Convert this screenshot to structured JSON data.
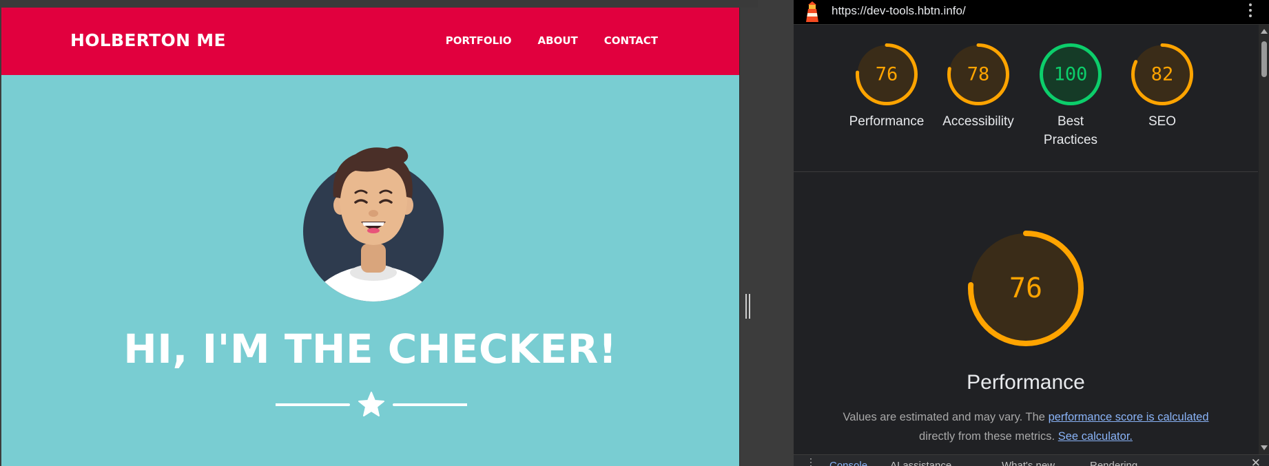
{
  "preview": {
    "brand": "HOLBERTON ME",
    "nav": [
      "PORTFOLIO",
      "ABOUT",
      "CONTACT"
    ],
    "hero_title": "HI, I'M THE CHECKER!",
    "colors": {
      "header": "#e1003e",
      "hero": "#79cdd2"
    }
  },
  "devtools": {
    "url": "https://dev-tools.hbtn.info/",
    "scores": [
      {
        "value": "76",
        "label": "Performance",
        "fraction": 0.76,
        "color": "#ffa400",
        "track": "#3a2c18"
      },
      {
        "value": "78",
        "label": "Accessibility",
        "fraction": 0.78,
        "color": "#ffa400",
        "track": "#3a2c18"
      },
      {
        "value": "100",
        "label_line1": "Best",
        "label_line2": "Practices",
        "fraction": 1.0,
        "color": "#0cce6b",
        "track": "#153b27"
      },
      {
        "value": "82",
        "label": "SEO",
        "fraction": 0.82,
        "color": "#ffa400",
        "track": "#3a2c18"
      }
    ],
    "main": {
      "value": "76",
      "fraction": 0.76,
      "title": "Performance",
      "note_prefix": "Values are estimated and may vary. The ",
      "note_link1": "performance score is calculated",
      "note_middle": "directly from these metrics.",
      "note_link2": "See calculator."
    },
    "drawer_tabs": [
      "Console",
      "AI assistance",
      "What's new",
      "Rendering"
    ]
  }
}
